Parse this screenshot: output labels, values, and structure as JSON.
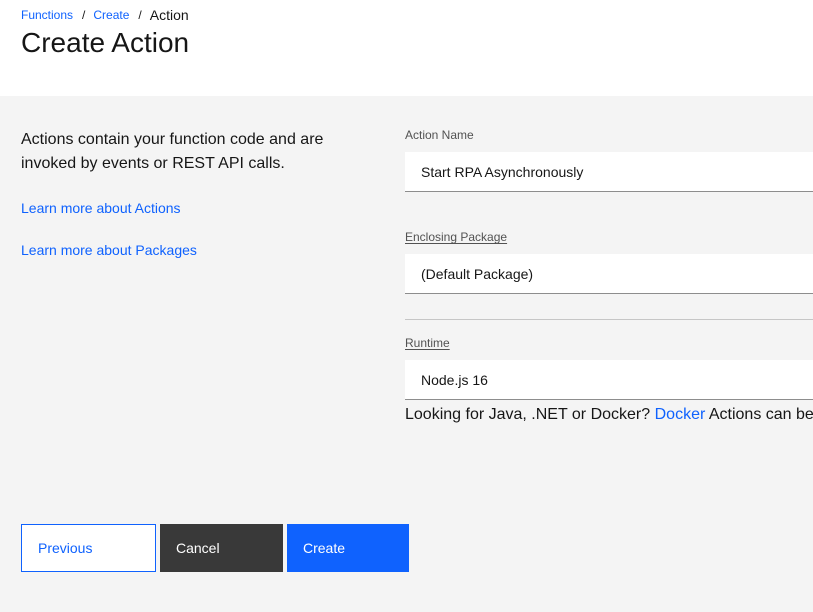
{
  "breadcrumb": {
    "items": [
      "Functions",
      "Create"
    ],
    "separator": "/",
    "current": "Action"
  },
  "page_title": "Create Action",
  "intro": {
    "description": "Actions contain your function code and are invoked by events or REST API calls.",
    "link_actions": "Learn more about Actions",
    "link_packages": "Learn more about Packages"
  },
  "form": {
    "action_name": {
      "label": "Action Name",
      "value": "Start RPA Asynchronously"
    },
    "enclosing_package": {
      "label": "Enclosing Package",
      "value": "(Default Package)"
    },
    "runtime": {
      "label": "Runtime",
      "value": "Node.js 16"
    },
    "helper": {
      "prefix": "Looking for Java, .NET or Docker?",
      "link": "Docker",
      "suffix": "Actions can be c"
    }
  },
  "buttons": {
    "previous": "Previous",
    "cancel": "Cancel",
    "create": "Create"
  },
  "colors": {
    "link": "#0f62fe",
    "primary": "#0f62fe",
    "secondary": "#393939",
    "background": "#f4f4f4"
  }
}
